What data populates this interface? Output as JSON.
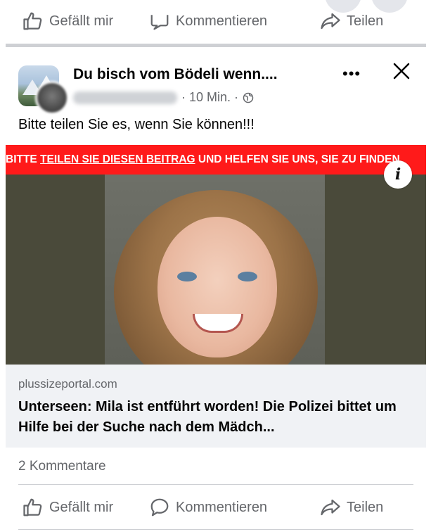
{
  "top_actions": {
    "like_label": "Gefällt mir",
    "comment_label": "Kommentieren",
    "share_label": "Teilen"
  },
  "post": {
    "group_name": "Du bisch vom Bödeli wenn....",
    "time": "· 10 Min. ·",
    "text": "Bitte teilen Sie es, wenn Sie können!!!",
    "more_icon": "•••",
    "banner": {
      "prefix": "BITTE ",
      "underlined": "TEILEN SIE DIESEN BEITRAG",
      "suffix": " UND HELFEN SIE UNS, SIE ZU FINDEN"
    },
    "info_icon": "i",
    "link": {
      "domain": "plussizeportal.com",
      "title": "Unterseen: Mila ist entführt worden! Die Polizei bittet um Hilfe bei der Suche nach dem Mädch..."
    },
    "comments_count": "2 Kommentare"
  },
  "bottom_actions": {
    "like_label": "Gefällt mir",
    "comment_label": "Kommentieren",
    "share_label": "Teilen"
  },
  "colors": {
    "banner_red": "#ff1a1a",
    "secondary_text": "#65676b",
    "link_bg": "#f0f2f5"
  }
}
